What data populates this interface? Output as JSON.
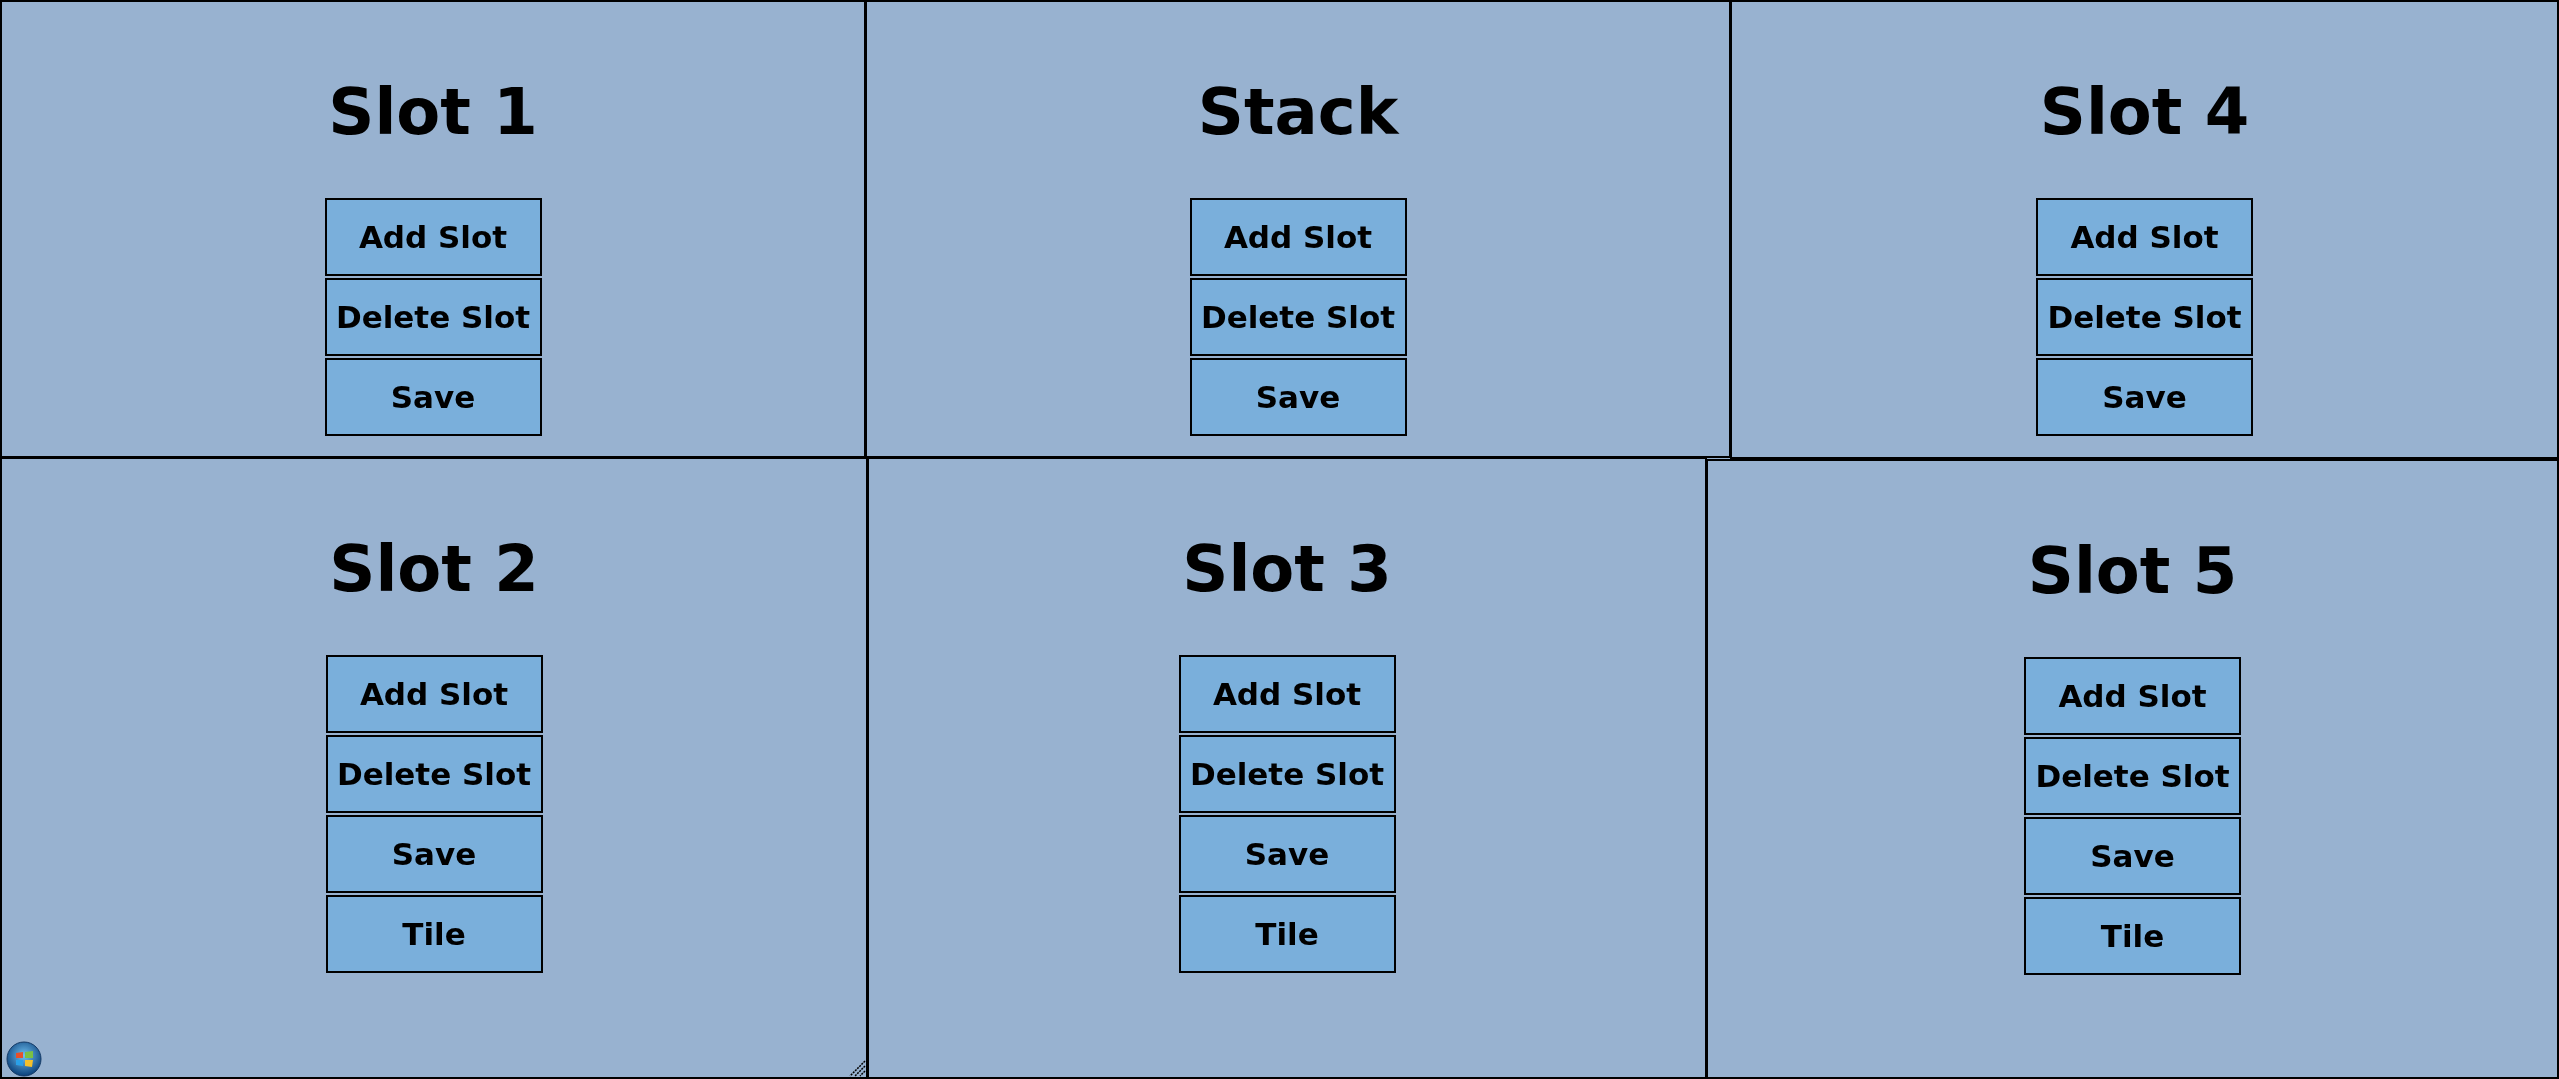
{
  "windows": [
    {
      "title": "Slot 1",
      "buttons": [
        "Add Slot",
        "Delete Slot",
        "Save"
      ]
    },
    {
      "title": "Stack",
      "buttons": [
        "Add Slot",
        "Delete Slot",
        "Save"
      ]
    },
    {
      "title": "Slot 4",
      "buttons": [
        "Add Slot",
        "Delete Slot",
        "Save"
      ]
    },
    {
      "title": "Slot 2",
      "buttons": [
        "Add Slot",
        "Delete Slot",
        "Save",
        "Tile"
      ],
      "resize_grip": true
    },
    {
      "title": "Slot 3",
      "buttons": [
        "Add Slot",
        "Delete Slot",
        "Save",
        "Tile"
      ],
      "resize_grip": false
    },
    {
      "title": "Slot 5",
      "buttons": [
        "Add Slot",
        "Delete Slot",
        "Save",
        "Tile"
      ],
      "resize_grip": false
    }
  ]
}
